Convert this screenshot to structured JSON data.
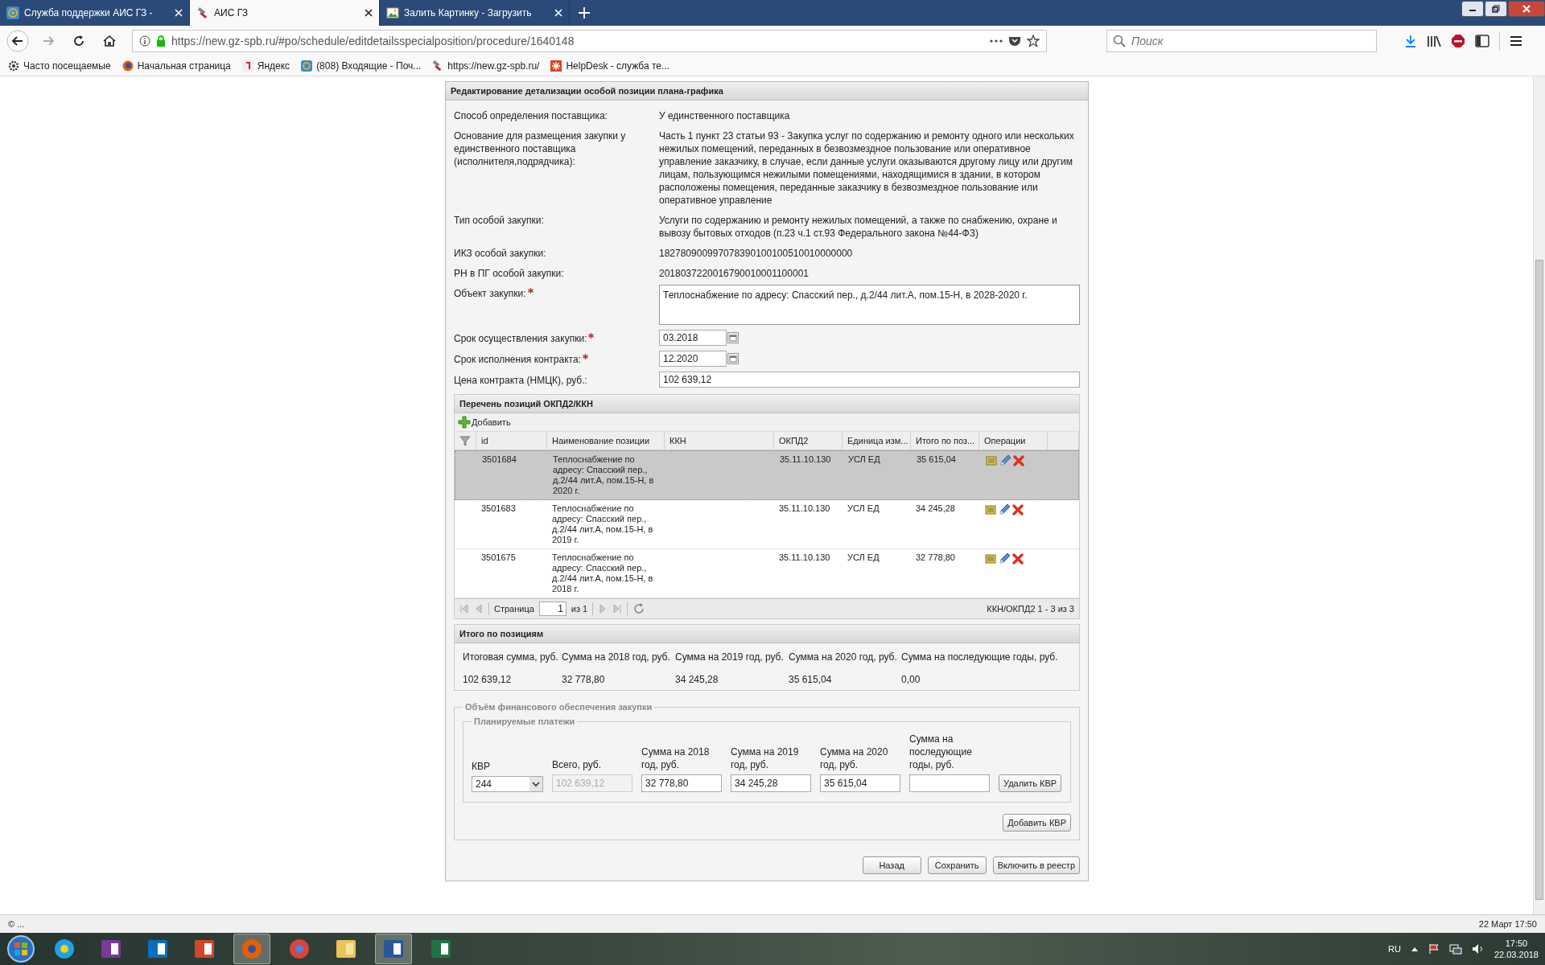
{
  "browser": {
    "tabs": [
      {
        "title": "Служба поддержки АИС ГЗ -",
        "selected": false
      },
      {
        "title": "АИС ГЗ",
        "selected": true
      },
      {
        "title": "Залить Картинку - Загрузить",
        "selected": false
      }
    ],
    "url": "https://new.gz-spb.ru/#po/schedule/editdetailsspecialposition/procedure/1640148",
    "search_placeholder": "Поиск",
    "bookmarks": [
      "Часто посещаемые",
      "Начальная страница",
      "Яндекс",
      "(808) Входящие - Поч...",
      "https://new.gz-spb.ru/",
      "HelpDesk - служба те..."
    ]
  },
  "form": {
    "title": "Редактирование детализации особой позиции плана-графика",
    "fields": [
      {
        "kind": "text",
        "label": "Способ определения поставщика:",
        "value": "У единственного поставщика",
        "required": false
      },
      {
        "kind": "text",
        "label": "Основание для размещения закупки у единственного поставщика (исполнителя,подрядчика):",
        "value": "Часть 1 пункт 23 статьи 93 - Закупка услуг по содержанию и ремонту одного или нескольких нежилых помещений, переданных в безвозмездное пользование или оперативное управление заказчику, в случае, если данные услуги оказываются другому лицу или другим лицам, пользующимся нежилыми помещениями, находящимися в здании, в котором расположены помещения, переданные заказчику в безвозмездное пользование или оперативное управление",
        "required": false
      },
      {
        "kind": "text",
        "label": "Тип особой закупки:",
        "value": "Услуги по содержанию и ремонту нежилых помещений, а также по снабжению, охране и вывозу бытовых отходов (п.23 ч.1 ст.93 Федерального закона №44-ФЗ)",
        "required": false
      },
      {
        "kind": "text",
        "label": "ИКЗ особой закупки:",
        "value": "182780900997078390100100510010000000",
        "required": false
      },
      {
        "kind": "text",
        "label": "РН в ПГ особой закупки:",
        "value": "2018037220016790010001100001",
        "required": false
      },
      {
        "kind": "textarea",
        "label": "Объект закупки:",
        "value": "Теплоснабжение по адресу: Спасский пер., д.2/44 лит.А, пом.15-Н, в 2028-2020 г.",
        "required": true
      },
      {
        "kind": "date",
        "label": "Срок осуществления закупки:",
        "value": "03.2018",
        "required": true
      },
      {
        "kind": "date",
        "label": "Срок исполнения контракта:",
        "value": "12.2020",
        "required": true
      },
      {
        "kind": "input",
        "label": "Цена контракта (НМЦК), руб.:",
        "value": "102 639,12",
        "required": false
      }
    ]
  },
  "grid": {
    "title": "Перечень позиций ОКПД2/ККН",
    "add_label": "Добавить",
    "columns": [
      "id",
      "Наименование позиции",
      "ККН",
      "ОКПД2",
      "Единица изм...",
      "Итого по поз...",
      "Операции"
    ],
    "rows": [
      {
        "id": "3501684",
        "name": "Теплоснабжение по адресу: Спасский пер., д.2/44 лит.А, пом.15-Н, в 2020 г.",
        "okpd2": "35.11.10.130",
        "unit": "УСЛ ЕД",
        "total": "35 615,04",
        "selected": true
      },
      {
        "id": "3501683",
        "name": "Теплоснабжение по адресу: Спасский пер., д.2/44 лит.А, пом.15-Н, в 2019 г.",
        "okpd2": "35.11.10.130",
        "unit": "УСЛ ЕД",
        "total": "34 245,28",
        "selected": false
      },
      {
        "id": "3501675",
        "name": "Теплоснабжение по адресу: Спасский пер., д.2/44 лит.А, пом.15-Н, в 2018 г.",
        "okpd2": "35.11.10.130",
        "unit": "УСЛ ЕД",
        "total": "32 778,80",
        "selected": false
      }
    ],
    "pager": {
      "page_label": "Страница",
      "page": "1",
      "of": "из 1",
      "summary": "ККН/ОКПД2 1 - 3 из 3"
    }
  },
  "totals": {
    "title": "Итого по позициям",
    "headers": [
      "Итоговая сумма, руб.",
      "Сумма на 2018 год, руб.",
      "Сумма на 2019 год, руб.",
      "Сумма на 2020 год, руб.",
      "Сумма на последующие годы, руб."
    ],
    "values": [
      "102 639,12",
      "32 778,80",
      "34 245,28",
      "35 615,04",
      "0,00"
    ]
  },
  "financing": {
    "legend": "Объём финансового обеспечения закупки",
    "payments_legend": "Планируемые платежи",
    "columns": [
      {
        "kind": "select",
        "label": "КВР",
        "value": "244",
        "disabled": false
      },
      {
        "kind": "input",
        "label": "Всего, руб.",
        "value": "102 639,12",
        "disabled": true
      },
      {
        "kind": "input",
        "label": "Сумма на 2018 год, руб.",
        "value": "32 778,80",
        "disabled": false
      },
      {
        "kind": "input",
        "label": "Сумма на 2019 год, руб.",
        "value": "34 245,28",
        "disabled": false
      },
      {
        "kind": "input",
        "label": "Сумма на 2020 год, руб.",
        "value": "35 615,04",
        "disabled": false
      },
      {
        "kind": "input",
        "label": "Сумма на последующие годы, руб.",
        "disabled": false
      }
    ],
    "delete_button": "Удалить КВР",
    "add_button": "Добавить КВР"
  },
  "actions": [
    "Назад",
    "Сохранить",
    "Включить в реестр"
  ],
  "status_bar": {
    "left": "© ...",
    "right": "22 Март 17:50"
  },
  "taskbar": {
    "language": "RU",
    "time": "17:50",
    "date": "22.03.2018"
  }
}
